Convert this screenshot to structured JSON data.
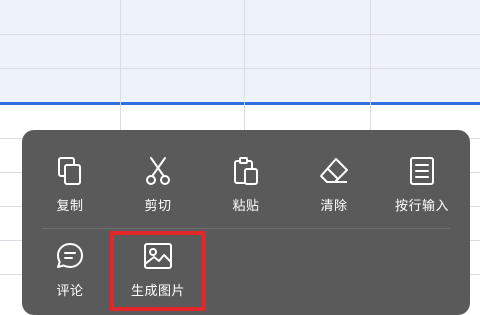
{
  "context_menu": {
    "row1": [
      {
        "label": "复制",
        "icon": "copy-icon"
      },
      {
        "label": "剪切",
        "icon": "scissors-icon"
      },
      {
        "label": "粘贴",
        "icon": "clipboard-icon"
      },
      {
        "label": "清除",
        "icon": "eraser-icon"
      },
      {
        "label": "按行输入",
        "icon": "row-input-icon"
      }
    ],
    "row2": [
      {
        "label": "评论",
        "icon": "comment-icon"
      },
      {
        "label": "生成图片",
        "icon": "image-icon"
      }
    ]
  },
  "colors": {
    "menu_background": "#5a5a5a",
    "selection_fill": "#eef2fb",
    "selection_border": "#2f6fe0",
    "highlight": "#e2262a"
  }
}
